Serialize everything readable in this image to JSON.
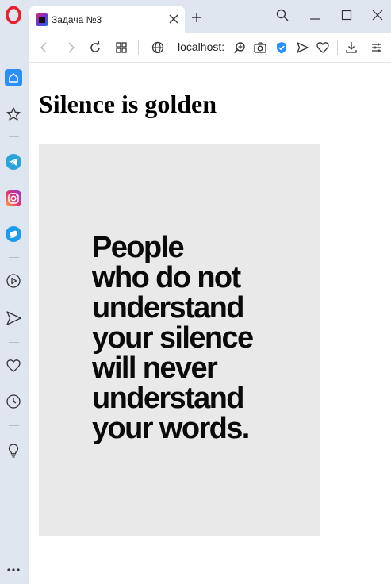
{
  "browser": {
    "tab": {
      "title": "Задача №3"
    },
    "address_bar": {
      "url": "localhost:"
    }
  },
  "page": {
    "heading": "Silence is golden",
    "poster": {
      "lines": [
        "People",
        "who do not",
        "understand",
        "your silence",
        "will never",
        "understand",
        "your words."
      ]
    }
  },
  "colors": {
    "chrome_bg": "#dfe6ef",
    "opera_red": "#e8212d",
    "active_blue": "#2a8ff7",
    "telegram": "#2aa3dc",
    "twitter": "#1d9bf0",
    "poster_bg": "#e9e9e9"
  }
}
